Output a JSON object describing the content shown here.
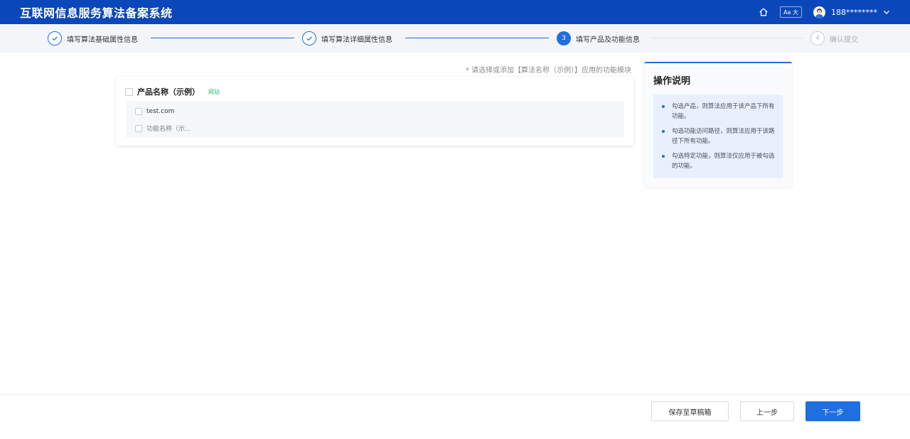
{
  "header": {
    "title": "互联网信息服务算法备案系统",
    "font_toggle_label": "Aa 大",
    "user_name": "188********",
    "home_icon": "home-icon",
    "chevron_icon": "chevron-down-icon"
  },
  "steps": [
    {
      "number": "1",
      "label": "填写算法基础属性信息",
      "status": "done"
    },
    {
      "number": "2",
      "label": "填写算法详细属性信息",
      "status": "done"
    },
    {
      "number": "3",
      "label": "填写产品及功能信息",
      "status": "active"
    },
    {
      "number": "4",
      "label": "确认提交",
      "status": "pending"
    }
  ],
  "hint": "* 请选择或添加【算法名称（示例）】应用的功能模块",
  "product": {
    "name": "产品名称（示例）",
    "tag": "网站",
    "items": [
      {
        "label": "test.com"
      },
      {
        "label": "功能名称（示..."
      }
    ]
  },
  "instructions": {
    "title": "操作说明",
    "items": [
      "勾选产品，则算法应用于该产品下所有功能。",
      "勾选功能访问路径，则算法应用于该路径下所有功能。",
      "勾选特定功能，则算法仅应用于被勾选的功能。"
    ]
  },
  "footer": {
    "save_draft": "保存至草稿箱",
    "prev": "上一步",
    "next": "下一步"
  },
  "colors": {
    "header_bg": "#0a47b8",
    "accent": "#1f6fe0",
    "tag": "#2bb673"
  }
}
